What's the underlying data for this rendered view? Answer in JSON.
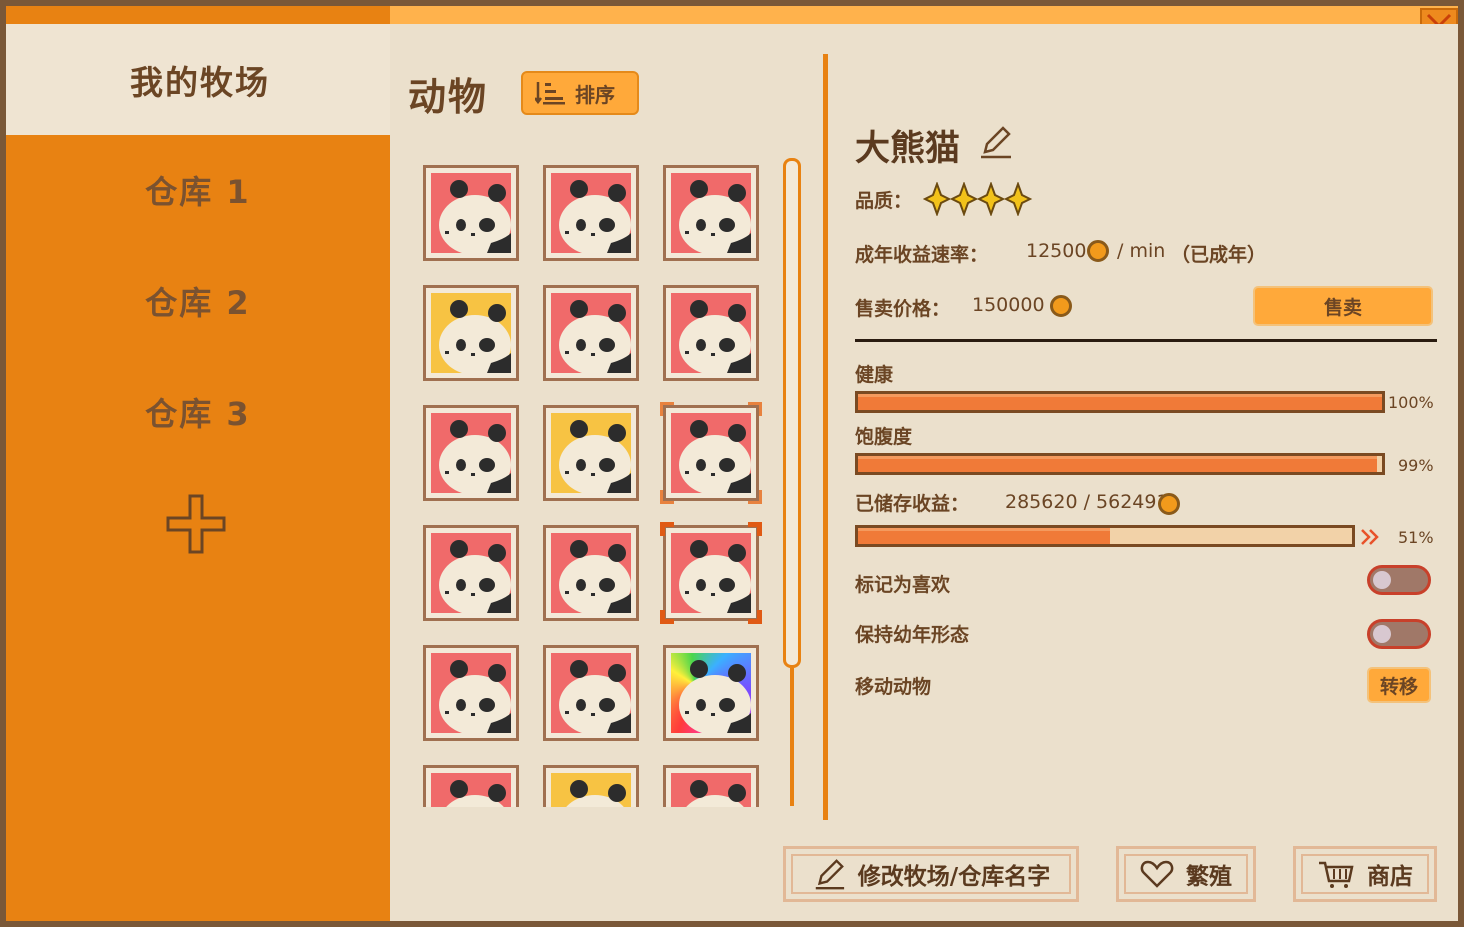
{
  "window": {
    "close_icon": "close-x-icon"
  },
  "sidebar": {
    "title": "我的牧场",
    "warehouses": [
      {
        "label": "仓库 1"
      },
      {
        "label": "仓库 2"
      },
      {
        "label": "仓库 3"
      }
    ],
    "add_icon": "plus-icon"
  },
  "animals_panel": {
    "title": "动物",
    "sort_label": "排序",
    "grid": [
      {
        "bg": "red"
      },
      {
        "bg": "red"
      },
      {
        "bg": "red"
      },
      {
        "bg": "yellow"
      },
      {
        "bg": "red"
      },
      {
        "bg": "red"
      },
      {
        "bg": "red"
      },
      {
        "bg": "yellow"
      },
      {
        "bg": "red",
        "marked": "light"
      },
      {
        "bg": "red"
      },
      {
        "bg": "red"
      },
      {
        "bg": "red",
        "marked": "selected"
      },
      {
        "bg": "red"
      },
      {
        "bg": "red"
      },
      {
        "bg": "rainbow"
      },
      {
        "bg": "red"
      },
      {
        "bg": "yellow"
      },
      {
        "bg": "red"
      }
    ]
  },
  "detail": {
    "name": "大熊猫",
    "quality_label": "品质：",
    "quality_stars": 4,
    "rate_label": "成年收益速率：",
    "rate_value": "12500",
    "rate_unit": "/ min",
    "rate_status": "（已成年）",
    "price_label": "售卖价格：",
    "price_value": "150000",
    "sell_label": "售卖",
    "health_label": "健康",
    "health_pct": "100%",
    "health_value": 1.0,
    "satiety_label": "饱腹度",
    "satiety_pct": "99%",
    "satiety_value": 0.99,
    "stored_label": "已储存收益：",
    "stored_value": "285620 / 562491",
    "stored_pct": "51%",
    "stored_fraction": 0.51,
    "favorite_label": "标记为喜欢",
    "favorite_on": false,
    "juvenile_label": "保持幼年形态",
    "juvenile_on": false,
    "move_label": "移动动物",
    "transfer_label": "转移"
  },
  "footer": {
    "rename_label": "修改牧场/仓库名字",
    "breed_label": "繁殖",
    "shop_label": "商店"
  },
  "colors": {
    "accent_orange": "#e88212",
    "bar_fill": "#f07a38",
    "panel_bg": "#ebe0cc",
    "text_brown": "#6b4524"
  }
}
